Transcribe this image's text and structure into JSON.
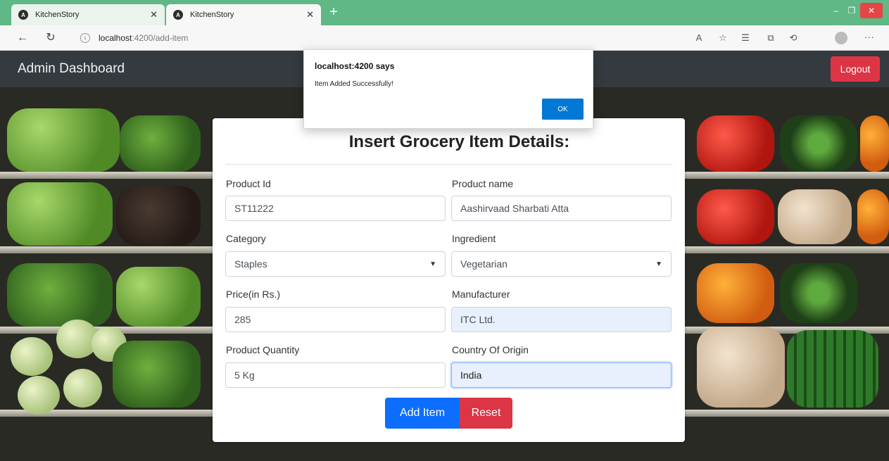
{
  "browser": {
    "tabs": [
      {
        "title": "KitchenStory",
        "active": false
      },
      {
        "title": "KitchenStory",
        "active": true
      }
    ],
    "url_host": "localhost",
    "url_path": ":4200/add-item",
    "favicon_glyph": "A"
  },
  "navbar": {
    "brand": "Admin Dashboard",
    "logout_label": "Logout",
    "logout_color": "#dc3545"
  },
  "form": {
    "title": "Insert Grocery Item Details:",
    "fields": {
      "product_id": {
        "label": "Product Id",
        "value": "ST11222"
      },
      "product_name": {
        "label": "Product name",
        "value": "Aashirvaad Sharbati Atta"
      },
      "category": {
        "label": "Category",
        "value": "Staples"
      },
      "ingredient": {
        "label": "Ingredient",
        "value": "Vegetarian"
      },
      "price": {
        "label": "Price(in Rs.)",
        "value": "285"
      },
      "manufacturer": {
        "label": "Manufacturer",
        "value": "ITC Ltd."
      },
      "quantity": {
        "label": "Product Quantity",
        "value": "5 Kg"
      },
      "country": {
        "label": "Country Of Origin",
        "value": "India"
      }
    },
    "add_label": "Add Item",
    "reset_label": "Reset",
    "add_color": "#0d6efd",
    "reset_color": "#dc3545"
  },
  "dialog": {
    "title": "localhost:4200 says",
    "message": "Item Added Successfully!",
    "ok_label": "OK",
    "ok_color": "#0078d4"
  }
}
